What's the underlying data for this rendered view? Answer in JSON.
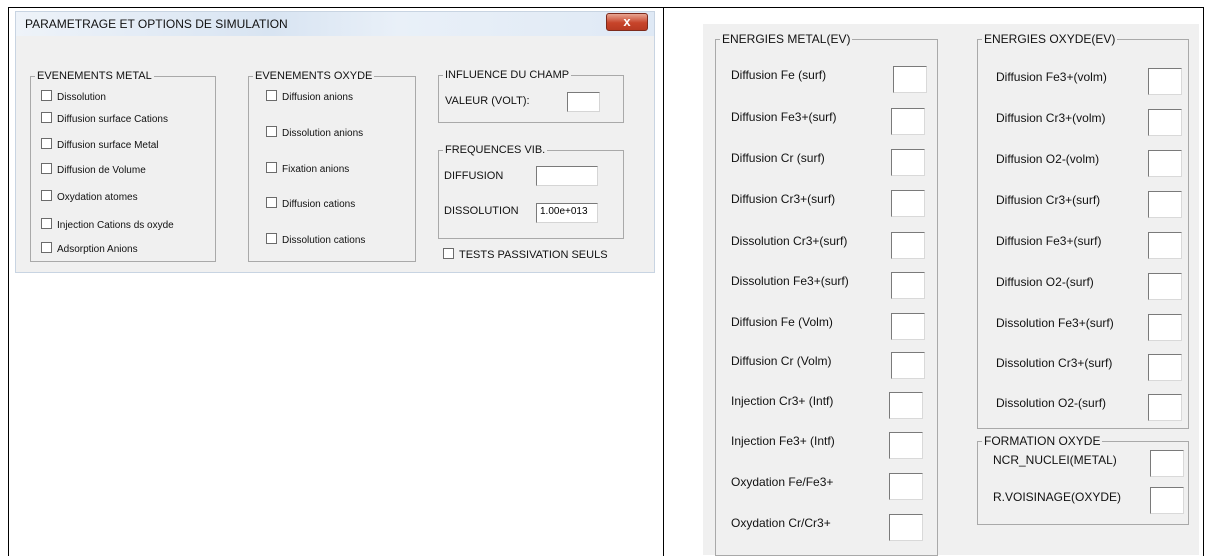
{
  "left_window": {
    "title": "PARAMETRAGE ET OPTIONS DE SIMULATION",
    "close_glyph": "x",
    "evenements_metal": {
      "legend": "EVENEMENTS METAL",
      "items": [
        "Dissolution",
        "Diffusion  surface  Cations",
        "Diffusion  surface  Metal",
        "Diffusion  de Volume",
        "Oxydation  atomes",
        "Injection  Cations ds oxyde",
        "Adsorption  Anions"
      ]
    },
    "evenements_oxyde": {
      "legend": "EVENEMENTS OXYDE",
      "items": [
        "Diffusion  anions",
        "Dissolution  anions",
        "Fixation   anions",
        "Diffusion  cations",
        "Dissolution cations"
      ]
    },
    "influence_champ": {
      "legend": "INFLUENCE DU CHAMP",
      "label": "VALEUR (VOLT):",
      "value": ""
    },
    "frequences": {
      "legend": "FREQUENCES VIB.",
      "diffusion_label": "DIFFUSION",
      "diffusion_value": "",
      "dissolution_label": "DISSOLUTION",
      "dissolution_value": "1.00e+013"
    },
    "tests_passivation": "TESTS PASSIVATION SEULS"
  },
  "right_window": {
    "energies_metal": {
      "legend": "ENERGIES   METAL(EV)",
      "items": [
        "Diffusion  Fe  (surf)",
        "Diffusion Fe3+(surf)",
        "Diffusion Cr (surf)",
        "Diffusion Cr3+(surf)",
        "Dissolution Cr3+(surf)",
        "Dissolution Fe3+(surf)",
        "Diffusion Fe (Volm)",
        "Diffusion Cr (Volm)",
        "Injection Cr3+ (Intf)",
        "Injection Fe3+ (Intf)",
        "Oxydation Fe/Fe3+",
        "Oxydation Cr/Cr3+"
      ]
    },
    "energies_oxyde": {
      "legend": "ENERGIES   OXYDE(EV)",
      "items": [
        "Diffusion  Fe3+(volm)",
        "Diffusion  Cr3+(volm)",
        "Diffusion    O2-(volm)",
        "Diffusion  Cr3+(surf)",
        "Diffusion  Fe3+(surf)",
        "Diffusion   O2-(surf)",
        "Dissolution  Fe3+(surf)",
        "Dissolution  Cr3+(surf)",
        "Dissolution  O2-(surf)"
      ]
    },
    "formation_oxyde": {
      "legend": "FORMATION OXYDE",
      "ncr_label": "NCR_NUCLEI(METAL)",
      "rvois_label": "R.VOISINAGE(OXYDE)"
    }
  }
}
